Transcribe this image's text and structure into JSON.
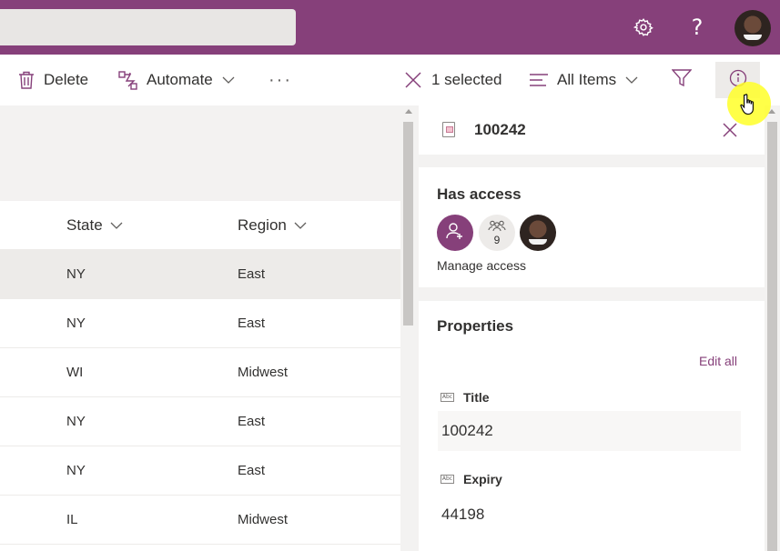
{
  "suite": {
    "help_label": "?",
    "icons": [
      "gear-icon",
      "help-icon",
      "avatar"
    ]
  },
  "commandbar": {
    "delete_label": "Delete",
    "automate_label": "Automate",
    "more_label": "···",
    "selected_label": "1 selected",
    "view_label": "All Items"
  },
  "list": {
    "columns": [
      "State",
      "Region"
    ],
    "rows": [
      {
        "state": "NY",
        "region": "East",
        "selected": true
      },
      {
        "state": "NY",
        "region": "East",
        "selected": false
      },
      {
        "state": "WI",
        "region": "Midwest",
        "selected": false
      },
      {
        "state": "NY",
        "region": "East",
        "selected": false
      },
      {
        "state": "NY",
        "region": "East",
        "selected": false
      },
      {
        "state": "IL",
        "region": "Midwest",
        "selected": false
      }
    ]
  },
  "details": {
    "title": "100242",
    "access_title": "Has access",
    "group_count": "9",
    "manage_label": "Manage access",
    "properties_title": "Properties",
    "edit_all_label": "Edit all",
    "fields": [
      {
        "label": "Title",
        "value": "100242"
      },
      {
        "label": "Expiry",
        "value": "44198"
      }
    ]
  },
  "colors": {
    "accent": "#86407a",
    "cursor_highlight": "#ffff28"
  }
}
